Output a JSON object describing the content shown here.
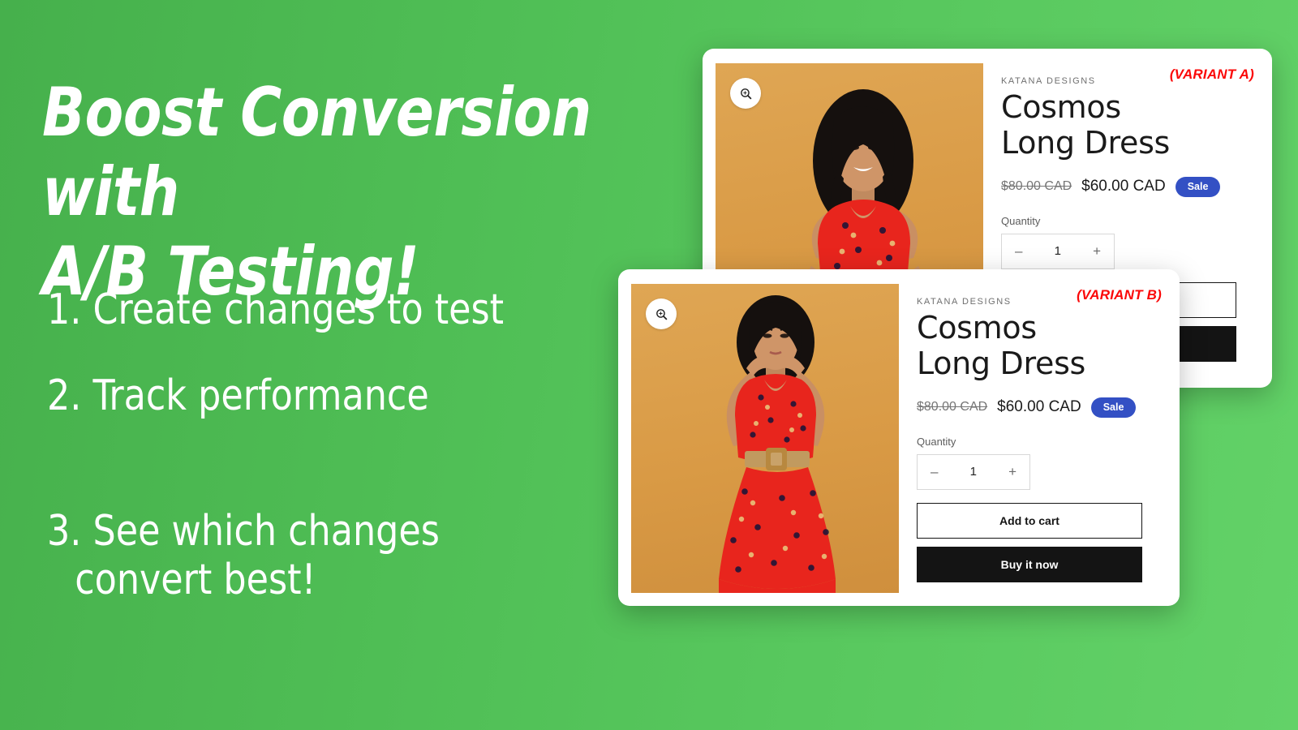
{
  "background": {
    "color_left": "#46b04c",
    "color_right": "#63d268"
  },
  "promo": {
    "headline": "Boost Conversion with\nA/B Testing!",
    "steps": [
      {
        "text": "1. Create changes to test"
      },
      {
        "text": "2. Track performance"
      },
      {
        "text": "3. See which changes",
        "continuation": "convert best!"
      }
    ]
  },
  "cards": [
    {
      "id": "variant-a",
      "variant_tag": "(VARIANT A)",
      "variant_tag_color": "#fb0808",
      "vendor": "KATANA DESIGNS",
      "title": "Cosmos Long Dress",
      "price_original": "$80.00 CAD",
      "price_current": "$60.00 CAD",
      "sale_badge": "Sale",
      "sale_badge_color": "#3350c4",
      "quantity_label": "Quantity",
      "quantity_value": "1",
      "quantity_decrease": "–",
      "quantity_increase": "+",
      "add_to_cart_label": "",
      "buy_now_label": "",
      "zoom_icon": "magnifier-zoom-icon",
      "image_alt": "Model in red floral dress, hands on hips, orange background"
    },
    {
      "id": "variant-b",
      "variant_tag": "(VARIANT B)",
      "variant_tag_color": "#fb0808",
      "vendor": "KATANA DESIGNS",
      "title": "Cosmos Long Dress",
      "price_original": "$80.00 CAD",
      "price_current": "$60.00 CAD",
      "sale_badge": "Sale",
      "sale_badge_color": "#3350c4",
      "quantity_label": "Quantity",
      "quantity_value": "1",
      "quantity_decrease": "–",
      "quantity_increase": "+",
      "add_to_cart_label": "Add to cart",
      "buy_now_label": "Buy it now",
      "zoom_icon": "magnifier-zoom-icon",
      "image_alt": "Model in red floral dress, hands raised to hair, orange background"
    }
  ]
}
